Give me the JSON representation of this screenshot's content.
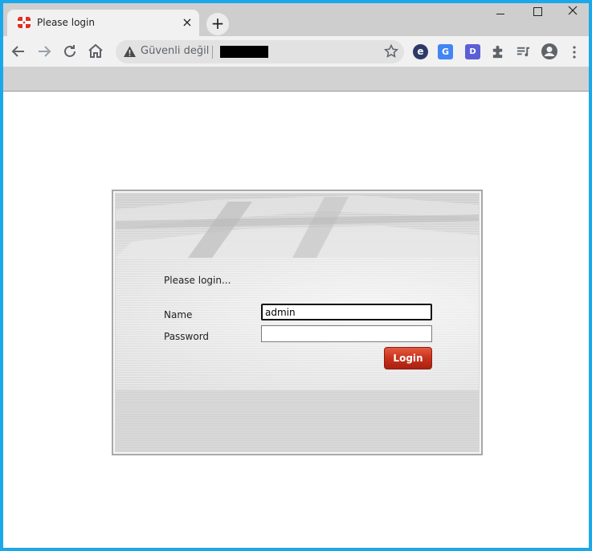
{
  "browser": {
    "tab": {
      "title": "Please login",
      "favicon": "fortinet-icon",
      "close": "×"
    },
    "new_tab": "+",
    "window_controls": {
      "close": "✕"
    },
    "omnibox": {
      "security_label": "Güvenli değil",
      "url": ""
    },
    "extensions": {
      "e": "e",
      "translate": "G",
      "d": "D"
    }
  },
  "login": {
    "heading": "Please login...",
    "name_label": "Name",
    "name_value": "admin",
    "password_label": "Password",
    "password_value": "",
    "button_label": "Login"
  },
  "colors": {
    "screen_border": "#1aa8e8",
    "login_button": "#c9311d",
    "favicon": "#e0301e"
  }
}
